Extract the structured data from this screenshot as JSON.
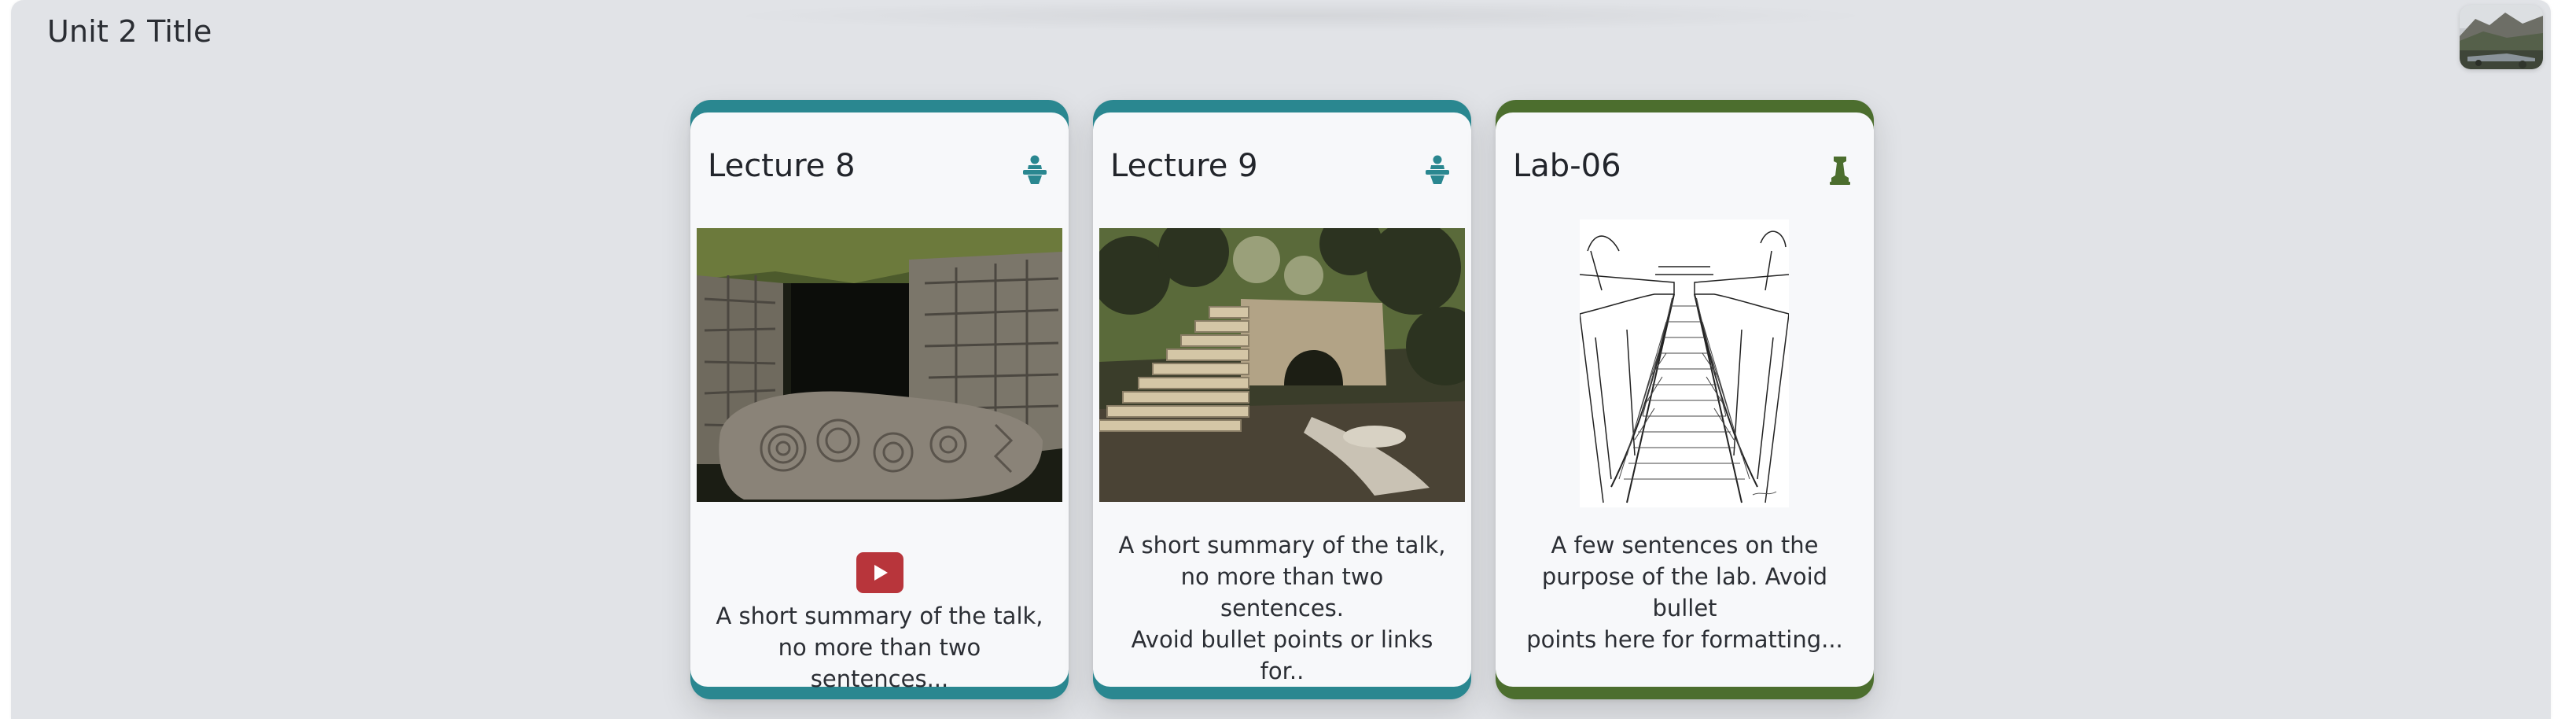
{
  "unit": {
    "title": "Unit 2 Title"
  },
  "colors": {
    "lecture_accent": "#2a8790",
    "lab_accent": "#4c6e2e",
    "video_button": "#b8353b",
    "panel_background": "#e1e3e7"
  },
  "cards": [
    {
      "title": "Lecture 8",
      "type_icon": "lecture-podium-icon",
      "media": "carved stone photo",
      "has_video": true,
      "video_icon": "youtube-play-icon",
      "summary_line1": "A short summary of the talk,",
      "summary_line2": "no more than two sentences..."
    },
    {
      "title": "Lecture 9",
      "type_icon": "lecture-podium-icon",
      "media": "stone bridge photo",
      "has_video": false,
      "summary_line1": "A short summary of the talk,",
      "summary_line2": "no more than two sentences.",
      "summary_line3": "Avoid bullet points or links for.."
    },
    {
      "title": "Lab-06",
      "type_icon": "lab-pawn-icon",
      "media": "rope bridge sketch",
      "has_video": false,
      "summary_line1": "A few sentences on the",
      "summary_line2": "purpose of the lab. Avoid bullet",
      "summary_line3": "points here for formatting..."
    }
  ]
}
